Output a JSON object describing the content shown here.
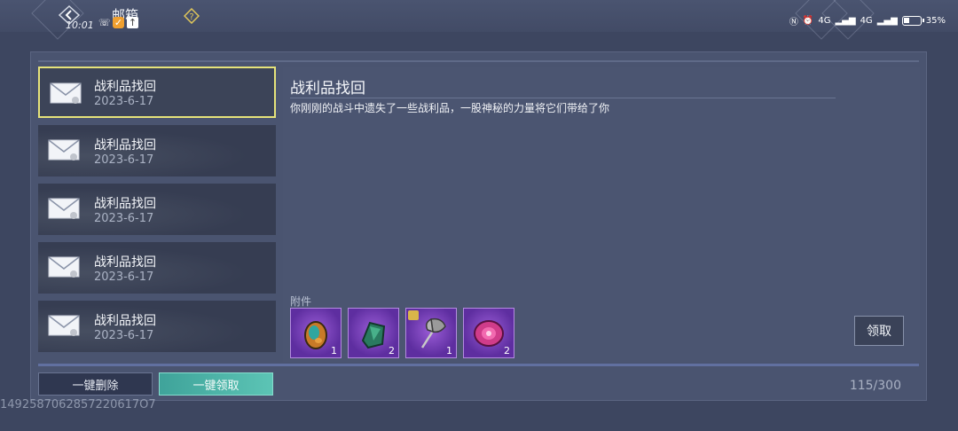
{
  "header": {
    "title": "邮箱",
    "back_icon": "back-arrow-icon",
    "help_icon": "question-mark-icon"
  },
  "status_bar": {
    "time": "10:01",
    "network_1": "4G",
    "network_2": "4G",
    "battery": "35%"
  },
  "mail_list": [
    {
      "title": "战利品找回",
      "date": "2023-6-17",
      "selected": true
    },
    {
      "title": "战利品找回",
      "date": "2023-6-17",
      "selected": false
    },
    {
      "title": "战利品找回",
      "date": "2023-6-17",
      "selected": false
    },
    {
      "title": "战利品找回",
      "date": "2023-6-17",
      "selected": false
    },
    {
      "title": "战利品找回",
      "date": "2023-6-17",
      "selected": false
    }
  ],
  "detail": {
    "title": "战利品找回",
    "body": "你刚刚的战斗中遗失了一些战利品，一股神秘的力量将它们带给了你",
    "attachments_label": "附件",
    "attachments": [
      {
        "icon": "amber-gem-icon",
        "count": "1"
      },
      {
        "icon": "green-crystal-icon",
        "count": "2"
      },
      {
        "icon": "battle-axe-icon",
        "count": "1"
      },
      {
        "icon": "pink-gem-icon",
        "count": "2"
      }
    ],
    "claim_label": "领取"
  },
  "footer": {
    "delete_all_label": "一键删除",
    "claim_all_label": "一键领取",
    "mail_count": "115/300"
  },
  "watermark": "1492587062857220617O7",
  "colors": {
    "selected_border": "#e6e37a",
    "claim_all_bg": "#4fb4a8",
    "slot_purple": "#7a40bf"
  }
}
